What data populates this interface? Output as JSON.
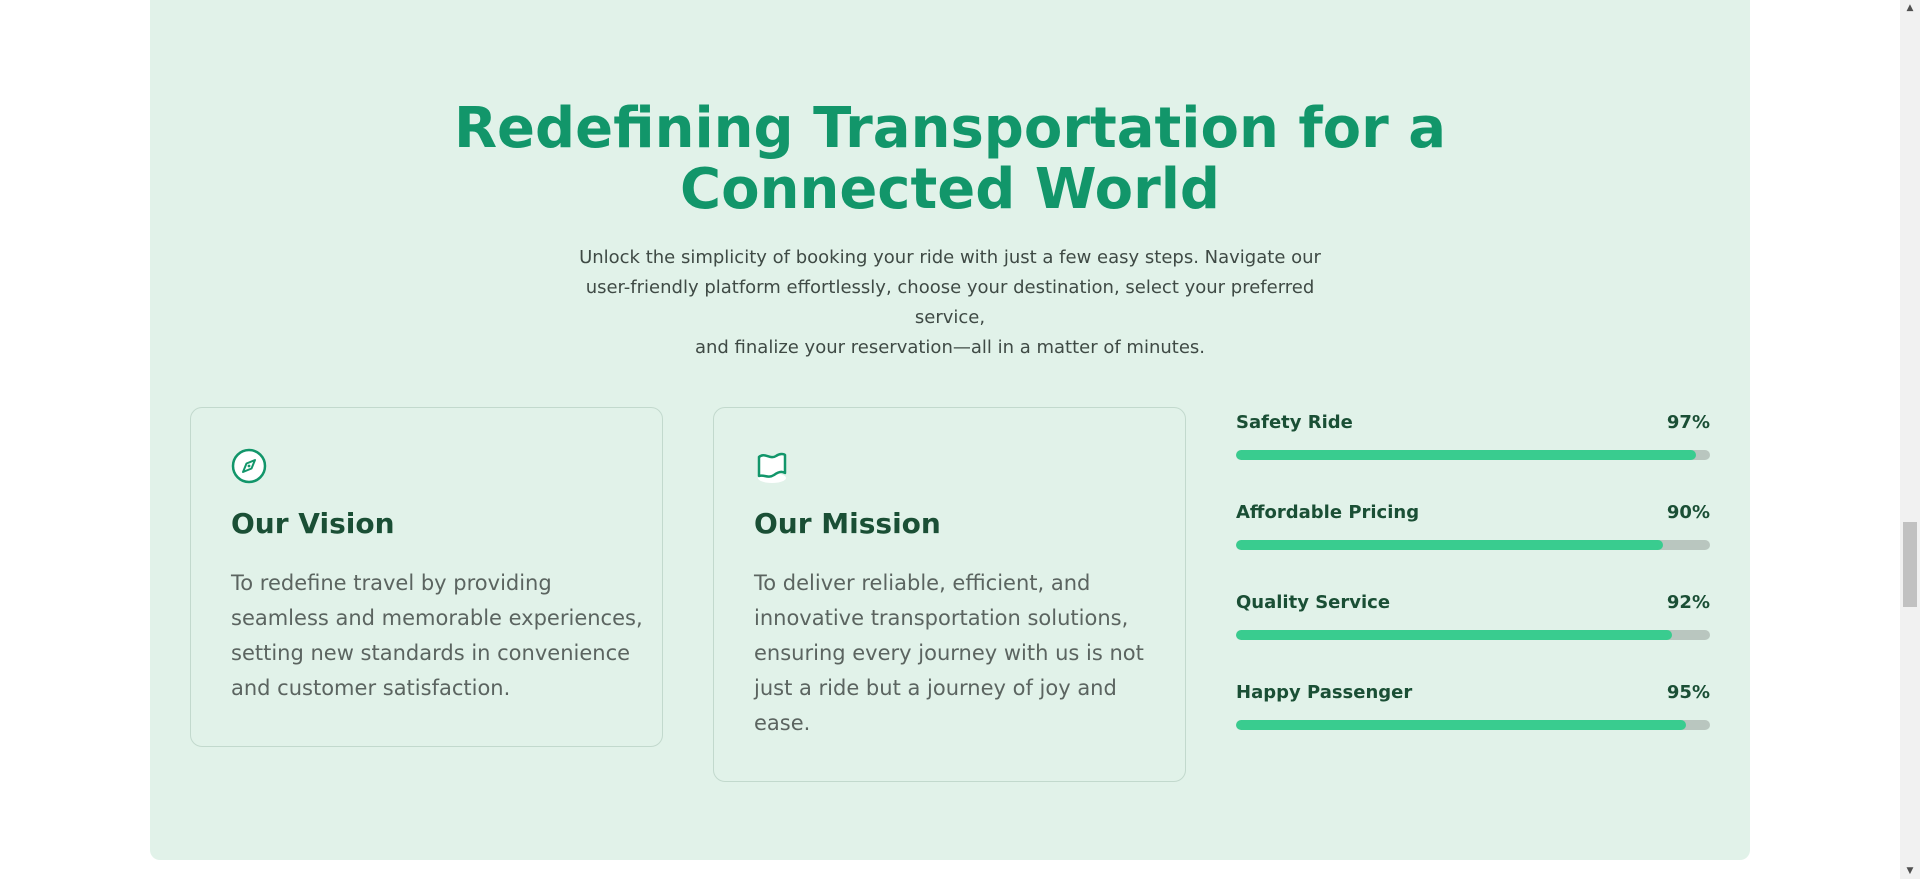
{
  "hero": {
    "title_lines": [
      "Redefining Transportation for a",
      "Connected World"
    ],
    "subtitle_lines": [
      "Unlock the simplicity of booking your ride with just a few easy steps. Navigate our",
      "user-friendly platform effortlessly, choose your destination, select your preferred service,",
      "and finalize your reservation—all in a matter of minutes."
    ]
  },
  "vision": {
    "icon": "compass-icon",
    "title": "Our Vision",
    "text_lines": [
      "To redefine travel by providing",
      "seamless and memorable experiences,",
      "setting new standards in convenience",
      "and customer satisfaction."
    ]
  },
  "mission": {
    "icon": "flag-icon",
    "title": "Our Mission",
    "text_lines": [
      "To deliver reliable, efficient, and",
      "innovative transportation solutions,",
      "ensuring every journey with us is not",
      "just a ride but a journey of joy and",
      "ease."
    ]
  },
  "stats": [
    {
      "label": "Safety Ride",
      "value": "97%",
      "percent": 97
    },
    {
      "label": "Affordable Pricing",
      "value": "90%",
      "percent": 90
    },
    {
      "label": "Quality Service",
      "value": "92%",
      "percent": 92
    },
    {
      "label": "Happy Passenger",
      "value": "95%",
      "percent": 95
    }
  ],
  "colors": {
    "accent": "#12966a",
    "section_bg": "#e1f2e9",
    "bar_fill": "#39cc8f",
    "bar_track": "#b9c6bf",
    "heading_dark": "#1a4f35"
  }
}
